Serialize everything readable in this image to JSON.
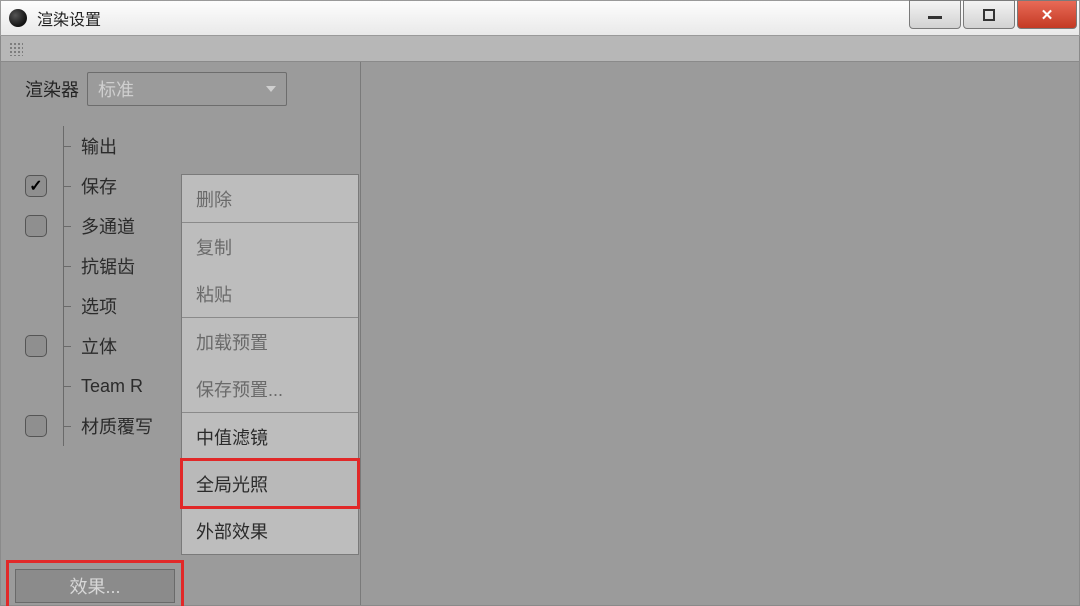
{
  "window": {
    "title": "渲染设置"
  },
  "renderer": {
    "label": "渲染器",
    "selected": "标准"
  },
  "settings": {
    "items": [
      {
        "key": "output",
        "label": "输出",
        "checkbox": null
      },
      {
        "key": "save",
        "label": "保存",
        "checkbox": true
      },
      {
        "key": "multipass",
        "label": "多通道",
        "checkbox": false
      },
      {
        "key": "antialias",
        "label": "抗锯齿",
        "checkbox": null
      },
      {
        "key": "options",
        "label": "选项",
        "checkbox": null
      },
      {
        "key": "stereo",
        "label": "立体",
        "checkbox": false
      },
      {
        "key": "team-render",
        "label": "Team R",
        "checkbox": null
      },
      {
        "key": "mat-override",
        "label": "材质覆写",
        "checkbox": false
      }
    ]
  },
  "effects_button": {
    "label": "效果..."
  },
  "context_menu": {
    "items": [
      {
        "key": "delete",
        "label": "删除",
        "enabled": false,
        "sep_after": true
      },
      {
        "key": "copy",
        "label": "复制",
        "enabled": false,
        "sep_after": false
      },
      {
        "key": "paste",
        "label": "粘贴",
        "enabled": false,
        "sep_after": true
      },
      {
        "key": "load-preset",
        "label": "加载预置",
        "enabled": false,
        "sep_after": false
      },
      {
        "key": "save-preset",
        "label": "保存预置...",
        "enabled": false,
        "sep_after": true
      },
      {
        "key": "median-filter",
        "label": "中值滤镜",
        "enabled": true,
        "sep_after": false
      },
      {
        "key": "global-illum",
        "label": "全局光照",
        "enabled": true,
        "sep_after": false,
        "highlighted": true
      },
      {
        "key": "external-effect",
        "label": "外部效果",
        "enabled": true,
        "sep_after": false
      }
    ]
  }
}
